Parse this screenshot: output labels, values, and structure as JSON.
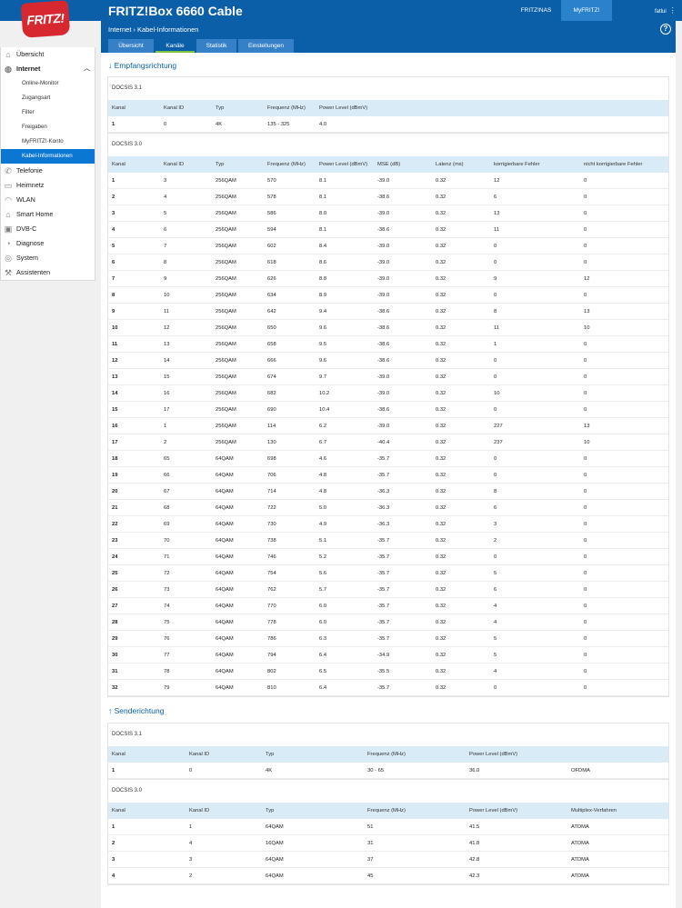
{
  "header": {
    "logo_text": "FRITZ!",
    "product_name": "FRITZ!Box 6660 Cable",
    "links": [
      "FRITZ!NAS",
      "MyFRITZ!"
    ],
    "user": "fatlui",
    "help_icon": "?"
  },
  "breadcrumb": {
    "section": "Internet",
    "page": "Kabel-Informationen"
  },
  "tabs": [
    "Übersicht",
    "Kanäle",
    "Statistik",
    "Einstellungen"
  ],
  "active_tab": "Kanäle",
  "sidebar": {
    "items": [
      {
        "label": "Übersicht",
        "icon": "home-icon"
      },
      {
        "label": "Internet",
        "icon": "globe-icon",
        "expanded": true,
        "children": [
          "Online-Monitor",
          "Zugangsart",
          "Filter",
          "Freigaben",
          "MyFRITZ!-Konto",
          "Kabel-Informationen"
        ],
        "active_child": "Kabel-Informationen"
      },
      {
        "label": "Telefonie",
        "icon": "phone-icon"
      },
      {
        "label": "Heimnetz",
        "icon": "network-icon"
      },
      {
        "label": "WLAN",
        "icon": "wifi-icon"
      },
      {
        "label": "Smart Home",
        "icon": "smart-home-icon"
      },
      {
        "label": "DVB-C",
        "icon": "tv-icon"
      },
      {
        "label": "Diagnose",
        "icon": "diagnose-icon"
      },
      {
        "label": "System",
        "icon": "system-icon"
      },
      {
        "label": "Assistenten",
        "icon": "wizard-icon"
      }
    ]
  },
  "downstream": {
    "heading": "↓ Empfangsrichtung",
    "docsis31": {
      "title": "DOCSIS 3.1",
      "columns": [
        "Kanal",
        "Kanal ID",
        "Typ",
        "Frequenz (MHz)",
        "Power Level (dBmV)"
      ],
      "rows": [
        [
          "1",
          "0",
          "4K",
          "135 - 325",
          "4.0"
        ]
      ]
    },
    "docsis30": {
      "title": "DOCSIS 3.0",
      "columns": [
        "Kanal",
        "Kanal ID",
        "Typ",
        "Frequenz (MHz)",
        "Power Level (dBmV)",
        "MSE (dB)",
        "Latenz (ms)",
        "korrigierbare Fehler",
        "nicht korrigierbare Fehler"
      ],
      "rows": [
        [
          "1",
          "3",
          "256QAM",
          "570",
          "8.1",
          "-39.0",
          "0.32",
          "12",
          "0"
        ],
        [
          "2",
          "4",
          "256QAM",
          "578",
          "8.1",
          "-38.6",
          "0.32",
          "6",
          "0"
        ],
        [
          "3",
          "5",
          "256QAM",
          "586",
          "8.0",
          "-39.0",
          "0.32",
          "13",
          "0"
        ],
        [
          "4",
          "6",
          "256QAM",
          "594",
          "8.1",
          "-38.6",
          "0.32",
          "11",
          "0"
        ],
        [
          "5",
          "7",
          "256QAM",
          "602",
          "8.4",
          "-39.0",
          "0.32",
          "0",
          "0"
        ],
        [
          "6",
          "8",
          "256QAM",
          "618",
          "8.6",
          "-39.0",
          "0.32",
          "0",
          "0"
        ],
        [
          "7",
          "9",
          "256QAM",
          "626",
          "8.8",
          "-39.0",
          "0.32",
          "9",
          "12"
        ],
        [
          "8",
          "10",
          "256QAM",
          "634",
          "8.9",
          "-39.0",
          "0.32",
          "0",
          "0"
        ],
        [
          "9",
          "11",
          "256QAM",
          "642",
          "9.4",
          "-38.6",
          "0.32",
          "8",
          "13"
        ],
        [
          "10",
          "12",
          "256QAM",
          "650",
          "9.6",
          "-38.6",
          "0.32",
          "11",
          "10"
        ],
        [
          "11",
          "13",
          "256QAM",
          "658",
          "9.5",
          "-38.6",
          "0.32",
          "1",
          "0"
        ],
        [
          "12",
          "14",
          "256QAM",
          "666",
          "9.6",
          "-38.6",
          "0.32",
          "0",
          "0"
        ],
        [
          "13",
          "15",
          "256QAM",
          "674",
          "9.7",
          "-39.0",
          "0.32",
          "0",
          "0"
        ],
        [
          "14",
          "16",
          "256QAM",
          "682",
          "10.2",
          "-39.0",
          "0.32",
          "10",
          "0"
        ],
        [
          "15",
          "17",
          "256QAM",
          "690",
          "10.4",
          "-38.6",
          "0.32",
          "0",
          "0"
        ],
        [
          "16",
          "1",
          "256QAM",
          "114",
          "6.2",
          "-39.0",
          "0.32",
          "227",
          "13"
        ],
        [
          "17",
          "2",
          "256QAM",
          "130",
          "6.7",
          "-40.4",
          "0.32",
          "237",
          "10"
        ],
        [
          "18",
          "65",
          "64QAM",
          "698",
          "4.6",
          "-35.7",
          "0.32",
          "0",
          "0"
        ],
        [
          "19",
          "66",
          "64QAM",
          "706",
          "4.8",
          "-35.7",
          "0.32",
          "0",
          "0"
        ],
        [
          "20",
          "67",
          "64QAM",
          "714",
          "4.8",
          "-36.3",
          "0.32",
          "8",
          "0"
        ],
        [
          "21",
          "68",
          "64QAM",
          "722",
          "5.0",
          "-36.3",
          "0.32",
          "6",
          "0"
        ],
        [
          "22",
          "69",
          "64QAM",
          "730",
          "4.9",
          "-36.3",
          "0.32",
          "3",
          "0"
        ],
        [
          "23",
          "70",
          "64QAM",
          "738",
          "5.1",
          "-35.7",
          "0.32",
          "2",
          "0"
        ],
        [
          "24",
          "71",
          "64QAM",
          "746",
          "5.2",
          "-35.7",
          "0.32",
          "0",
          "0"
        ],
        [
          "25",
          "72",
          "64QAM",
          "754",
          "5.6",
          "-35.7",
          "0.32",
          "5",
          "0"
        ],
        [
          "26",
          "73",
          "64QAM",
          "762",
          "5.7",
          "-35.7",
          "0.32",
          "6",
          "0"
        ],
        [
          "27",
          "74",
          "64QAM",
          "770",
          "6.0",
          "-35.7",
          "0.32",
          "4",
          "0"
        ],
        [
          "28",
          "75",
          "64QAM",
          "778",
          "6.0",
          "-35.7",
          "0.32",
          "4",
          "0"
        ],
        [
          "29",
          "76",
          "64QAM",
          "786",
          "6.3",
          "-35.7",
          "0.32",
          "5",
          "0"
        ],
        [
          "30",
          "77",
          "64QAM",
          "794",
          "6.4",
          "-34.9",
          "0.32",
          "5",
          "0"
        ],
        [
          "31",
          "78",
          "64QAM",
          "802",
          "6.5",
          "-35.5",
          "0.32",
          "4",
          "0"
        ],
        [
          "32",
          "79",
          "64QAM",
          "810",
          "6.4",
          "-35.7",
          "0.32",
          "0",
          "0"
        ]
      ]
    }
  },
  "upstream": {
    "heading": "↑ Senderichtung",
    "docsis31": {
      "title": "DOCSIS 3.1",
      "columns": [
        "Kanal",
        "Kanal ID",
        "Typ",
        "Frequenz (MHz)",
        "Power Level (dBmV)",
        ""
      ],
      "rows": [
        [
          "1",
          "0",
          "4K",
          "30 - 65",
          "36.0",
          "OFDMA"
        ]
      ]
    },
    "docsis30": {
      "title": "DOCSIS 3.0",
      "columns": [
        "Kanal",
        "Kanal ID",
        "Typ",
        "Frequenz (MHz)",
        "Power Level (dBmV)",
        "Multiplex-Verfahren"
      ],
      "rows": [
        [
          "1",
          "1",
          "64QAM",
          "51",
          "41.5",
          "ATDMA"
        ],
        [
          "2",
          "4",
          "16QAM",
          "31",
          "41.8",
          "ATDMA"
        ],
        [
          "3",
          "3",
          "64QAM",
          "37",
          "42.8",
          "ATDMA"
        ],
        [
          "4",
          "2",
          "64QAM",
          "45",
          "42.3",
          "ATDMA"
        ]
      ]
    }
  },
  "colors": {
    "brand_blue": "#0b5fa8",
    "header_row": "#d8ebf7",
    "active_nav": "#0b77d3",
    "logo_red": "#d7282f"
  }
}
